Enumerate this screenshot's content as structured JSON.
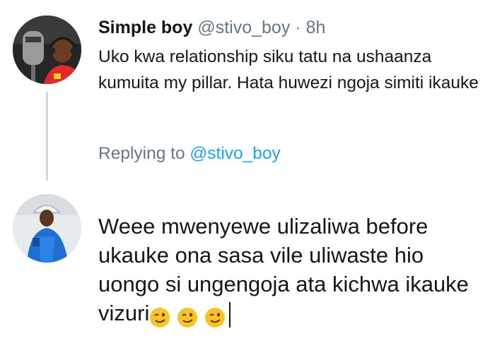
{
  "tweet": {
    "author_name": "Simple boy",
    "handle": "@stivo_boy",
    "separator": "·",
    "time": "8h",
    "text": "Uko kwa relationship siku tatu na ushaanza kumuita my pillar. Hata huwezi ngoja simiti ikauke",
    "avatar_icon": "user-avatar-photo-microphone"
  },
  "reply_context": {
    "label": "Replying to",
    "handle": "@stivo_boy"
  },
  "compose": {
    "text": "Weee mwenyewe ulizaliwa before ukauke ona sasa vile uliwaste hio uongo si ungengoja ata kichwa ikauke vizuri",
    "emojis": [
      "winking-face",
      "winking-face",
      "winking-face"
    ],
    "avatar_icon": "user-avatar-photo"
  },
  "colors": {
    "text": "#14171a",
    "secondary": "#657786",
    "link": "#1da1f2",
    "thread_line": "#cfd9de",
    "emoji": "#f8c326"
  }
}
